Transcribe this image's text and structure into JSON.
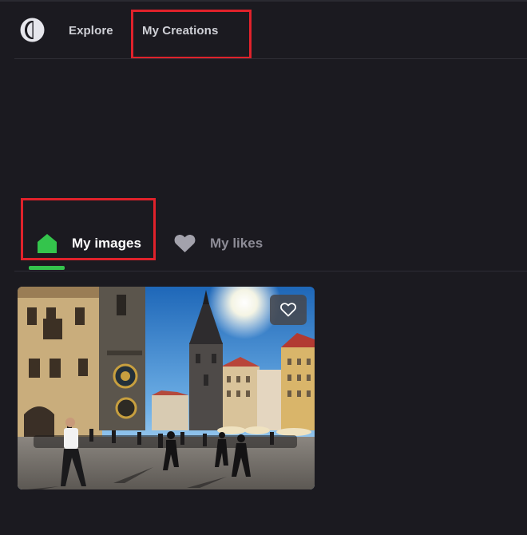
{
  "nav": {
    "explore_label": "Explore",
    "creations_label": "My Creations"
  },
  "tabs": [
    {
      "label": "My images",
      "icon": "home-icon",
      "active": true
    },
    {
      "label": "My likes",
      "icon": "heart-icon",
      "active": false
    }
  ],
  "gallery": {
    "items": [
      {
        "like_icon": "heart-outline-icon"
      }
    ]
  },
  "colors": {
    "background": "#1b1a20",
    "accent": "#34c44c",
    "highlight": "#e0222b"
  }
}
